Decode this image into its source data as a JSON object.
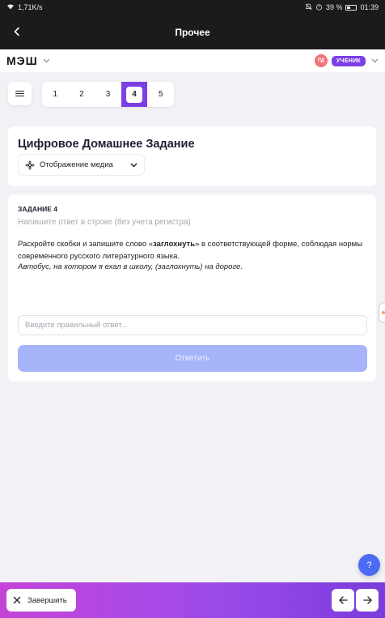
{
  "statusbar": {
    "speed": "1,71K/s",
    "battery": "39 %",
    "time": "01:39"
  },
  "appbar": {
    "title": "Прочее"
  },
  "header": {
    "brand": "МЭШ",
    "avatar_initials": "ПД",
    "role": "УЧЕНИК"
  },
  "pager": {
    "items": [
      "1",
      "2",
      "3",
      "4",
      "5"
    ],
    "active": "4"
  },
  "title_card": {
    "title": "Цифровое Домашнее Задание",
    "media_button": "Отображение медиа"
  },
  "task": {
    "number": "ЗАДАНИЕ 4",
    "hint": "Напишите ответ в строке (без учета регистра)",
    "text_before": "Раскройте скобки и запишите слово «",
    "text_bold": "заглохнуть",
    "text_after": "» в соответствующей форме, соблюдая нормы современного русского литературного языка.",
    "example": "Автобус, на котором я ехал в школу, (заглохнуть) на дороге.",
    "input_placeholder": "Введите правильный ответ...",
    "input_value": "",
    "submit_label": "Ответить"
  },
  "help": {
    "label": "?"
  },
  "bottom": {
    "finish_label": "Завершить"
  },
  "colors": {
    "accent": "#7b3fe4",
    "submit_disabled": "#a6b4fa",
    "help": "#4b6bf5",
    "avatar": "#f07378"
  }
}
